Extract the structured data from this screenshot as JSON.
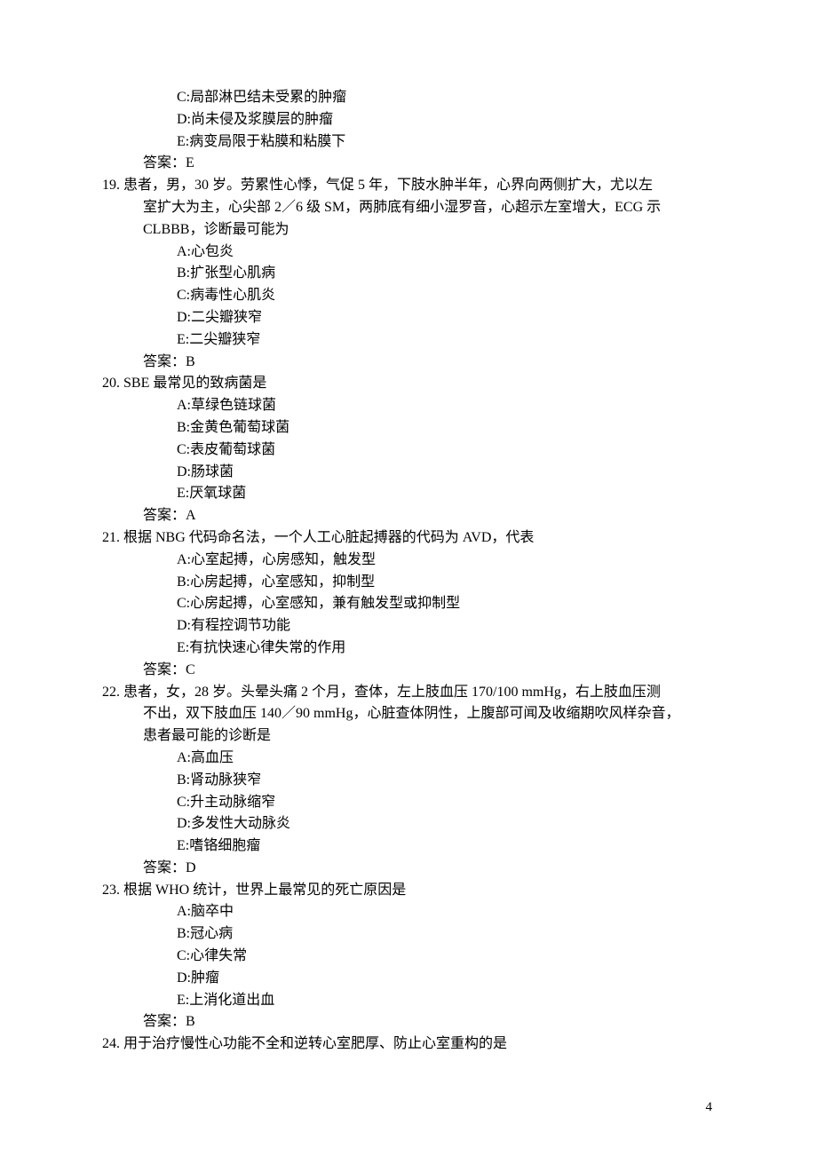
{
  "q18_tail": {
    "optC": "C:局部淋巴结未受累的肿瘤",
    "optD": "D:尚未侵及浆膜层的肿瘤",
    "optE": "E:病变局限于粘膜和粘膜下",
    "answer": "答案：E"
  },
  "q19": {
    "num": "19.",
    "stem1": "患者，男，30 岁。劳累性心悸，气促 5 年，下肢水肿半年，心界向两侧扩大，尤以左",
    "stem2": "室扩大为主，心尖部 2／6 级 SM，两肺底有细小湿罗音，心超示左室增大，ECG 示",
    "stem3": "CLBBB，诊断最可能为",
    "optA": "A:心包炎",
    "optB": "B:扩张型心肌病",
    "optC": "C:病毒性心肌炎",
    "optD": "D:二尖瓣狭窄",
    "optE": "E:二尖瓣狭窄",
    "answer": "答案：B"
  },
  "q20": {
    "num": "20.",
    "stem1": "SBE 最常见的致病菌是",
    "optA": "A:草绿色链球菌",
    "optB": "B:金黄色葡萄球菌",
    "optC": "C:表皮葡萄球菌",
    "optD": "D:肠球菌",
    "optE": "E:厌氧球菌",
    "answer": "答案：A"
  },
  "q21": {
    "num": "21.",
    "stem1": "根据 NBG 代码命名法，一个人工心脏起搏器的代码为 AVD，代表",
    "optA": "A:心室起搏，心房感知，触发型",
    "optB": "B:心房起搏，心室感知，抑制型",
    "optC": "C:心房起搏，心室感知，兼有触发型或抑制型",
    "optD": "D:有程控调节功能",
    "optE": "E:有抗快速心律失常的作用",
    "answer": "答案：C"
  },
  "q22": {
    "num": "22.",
    "stem1": "患者，女，28 岁。头晕头痛 2 个月，查体，左上肢血压 170/100 mmHg，右上肢血压测",
    "stem2": "不出，双下肢血压 140／90 mmHg，心脏查体阴性，上腹部可闻及收缩期吹风样杂音，",
    "stem3": "患者最可能的诊断是",
    "optA": "A:高血压",
    "optB": "B:肾动脉狭窄",
    "optC": "C:升主动脉缩窄",
    "optD": "D:多发性大动脉炎",
    "optE": "E:嗜铬细胞瘤",
    "answer": "答案：D"
  },
  "q23": {
    "num": "23.",
    "stem1": "根据 WHO 统计，世界上最常见的死亡原因是",
    "optA": "A:脑卒中",
    "optB": "B:冠心病",
    "optC": "C:心律失常",
    "optD": "D:肿瘤",
    "optE": "E:上消化道出血",
    "answer": "答案：B"
  },
  "q24": {
    "num": "24.",
    "stem1": "用于治疗慢性心功能不全和逆转心室肥厚、防止心室重构的是"
  },
  "page_number": "4"
}
